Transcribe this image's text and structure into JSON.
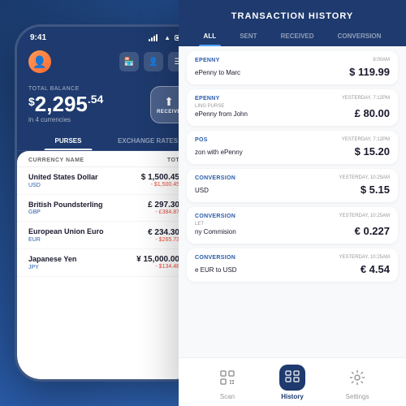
{
  "app": {
    "status_time": "9:41",
    "balance_label": "TOTAL BALANCE",
    "balance_integer": "2,295",
    "balance_decimal": ".54",
    "balance_symbol": "$",
    "balance_subtitle": "in 4 currencies",
    "receive_label": "RECEIVE",
    "tabs": [
      {
        "label": "PURSES",
        "active": true
      },
      {
        "label": "EXCHANGE RATES",
        "active": false
      }
    ],
    "currency_col_name": "CURRENCY NAME",
    "currency_col_total": "TOTAL",
    "currencies": [
      {
        "name": "United States Dollar",
        "code": "USD",
        "symbol": "$",
        "amount": "1,500.45",
        "change": "- $1,500.45"
      },
      {
        "name": "British Poundsterling",
        "code": "GBP",
        "symbol": "£",
        "amount": "297.30",
        "change": "- £384.87"
      },
      {
        "name": "European Union Euro",
        "code": "EUR",
        "symbol": "€",
        "amount": "234.30",
        "change": "- $265.73"
      },
      {
        "name": "Japanese Yen",
        "code": "JPY",
        "symbol": "¥",
        "amount": "15,000.00",
        "change": "- $134.48"
      }
    ]
  },
  "transactions": {
    "title": "TRANSACTION HISTORY",
    "filter_tabs": [
      {
        "label": "ALL",
        "active": true
      },
      {
        "label": "SENT",
        "active": false
      },
      {
        "label": "RECEIVED",
        "active": false
      },
      {
        "label": "CONVERSION",
        "active": false
      }
    ],
    "items": [
      {
        "sender": "EPENNY",
        "time": "8:00AM",
        "description": "ePenny to Marc",
        "amount": "$ 119.99",
        "symbol": "$"
      },
      {
        "sender": "EPENNY",
        "time": "YESTERDAY, 7:12PM",
        "description": "LING PURSE\nePenny from John",
        "desc_line1": "LING PURSE",
        "desc_line2": "ePenny from John",
        "amount": "£ 80.00",
        "symbol": "£"
      },
      {
        "sender": "POS",
        "time": "YESTERDAY, 7:12PM",
        "description": "zon with ePenny",
        "amount": "$ 15.20",
        "symbol": "$"
      },
      {
        "sender": "CONVERSION",
        "time": "YESTERDAY, 10:25AM",
        "description": "USD",
        "amount": "$ 5.15",
        "symbol": "$"
      },
      {
        "sender": "CONVERSION",
        "time": "YESTERDAY, 10:25AM",
        "description": "LET\nny Commision",
        "desc_line1": "LET",
        "desc_line2": "ny Commision",
        "amount": "€ 0.227",
        "symbol": "€"
      },
      {
        "sender": "CONVERSION",
        "time": "YESTERDAY, 10:25AM",
        "description": "e EUR to USD",
        "amount": "€ 4.54",
        "symbol": "€"
      }
    ],
    "nav": [
      {
        "label": "Scan",
        "icon": "⊡",
        "active": false
      },
      {
        "label": "History",
        "icon": "▦",
        "active": true
      },
      {
        "label": "Settings",
        "icon": "⚙",
        "active": false
      }
    ]
  }
}
